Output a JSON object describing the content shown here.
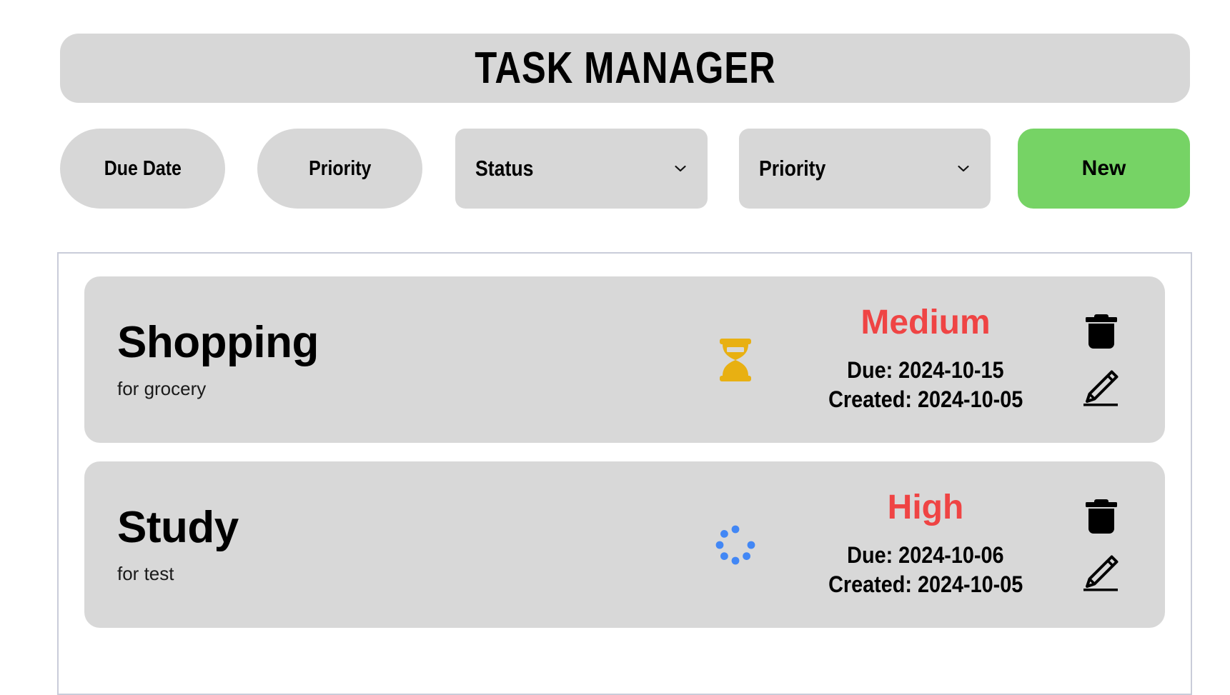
{
  "header": {
    "title": "TASK MANAGER",
    "background_color": "#d7d7d7"
  },
  "toolbar": {
    "sort_due_date_label": "Due Date",
    "sort_priority_label": "Priority",
    "status_filter": {
      "selected": "Status",
      "icon": "chevron-down-icon"
    },
    "priority_filter": {
      "selected": "Priority",
      "icon": "chevron-down-icon"
    },
    "new_button_label": "New",
    "new_button_color": "#76d365",
    "button_color": "#d7d7d7"
  },
  "task_list": {
    "border_color": "#c9ccd9",
    "card_color": "#d8d8d8",
    "priority_color": "#ef4444",
    "status_pending_color": "#e8b012",
    "status_progress_color": "#4287f5",
    "tasks": [
      {
        "title": "Shopping",
        "description": "for grocery",
        "status_icon": "hourglass-icon",
        "priority": "Medium",
        "due_label": "Due: 2024-10-15",
        "created_label": "Created: 2024-10-05",
        "delete_icon": "trash-icon",
        "edit_icon": "pencil-icon"
      },
      {
        "title": "Study",
        "description": "for test",
        "status_icon": "spinner-icon",
        "priority": "High",
        "due_label": "Due: 2024-10-06",
        "created_label": "Created: 2024-10-05",
        "delete_icon": "trash-icon",
        "edit_icon": "pencil-icon"
      }
    ]
  }
}
